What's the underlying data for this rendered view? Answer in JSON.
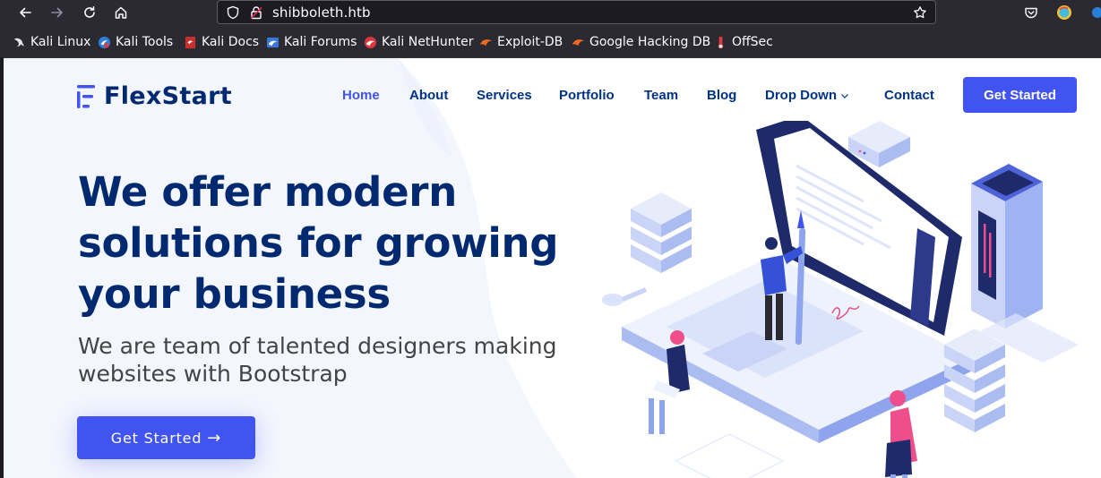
{
  "browser": {
    "url": "shibboleth.htb",
    "bookmarks": [
      {
        "label": "Kali Linux",
        "icon": "kali-dragon-icon"
      },
      {
        "label": "Kali Tools",
        "icon": "kali-tools-icon"
      },
      {
        "label": "Kali Docs",
        "icon": "kali-docs-icon"
      },
      {
        "label": "Kali Forums",
        "icon": "kali-forums-icon"
      },
      {
        "label": "Kali NetHunter",
        "icon": "kali-nethunter-icon"
      },
      {
        "label": "Exploit-DB",
        "icon": "exploit-db-icon"
      },
      {
        "label": "Google Hacking DB",
        "icon": "ghdb-icon"
      },
      {
        "label": "OffSec",
        "icon": "offsec-icon"
      }
    ]
  },
  "site": {
    "brand": "FlexStart",
    "nav": [
      "Home",
      "About",
      "Services",
      "Portfolio",
      "Team",
      "Blog",
      "Drop Down",
      "Contact"
    ],
    "nav_cta": "Get Started",
    "hero": {
      "title": "We offer modern solutions for growing your business",
      "subtitle": "We are team of talented designers making websites with Bootstrap",
      "cta": "Get Started",
      "cta_icon": "arrow-right-icon"
    }
  },
  "colors": {
    "primary": "#4154f1",
    "heading": "#012970",
    "nav": "#013289",
    "chrome": "#2b2a33",
    "url_bg": "#1c1b22",
    "hero_bg": "#f3f6fd"
  }
}
